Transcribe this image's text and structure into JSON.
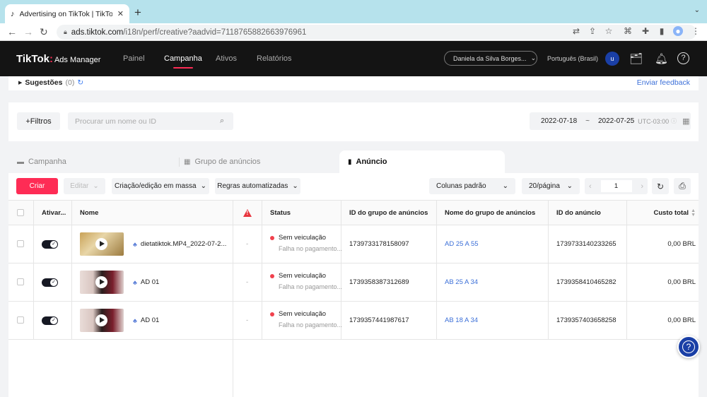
{
  "browser": {
    "tab_title": "Advertising on TikTok | TikTok Ads",
    "url_host": "ads.tiktok.com",
    "url_path": "/i18n/perf/creative?aadvid=7118765882663976961"
  },
  "header": {
    "logo": "TikTok",
    "product": "Ads Manager",
    "nav": [
      {
        "label": "Painel"
      },
      {
        "label": "Campanha"
      },
      {
        "label": "Ativos"
      },
      {
        "label": "Relatórios"
      }
    ],
    "account": "Daniela da Silva Borges...",
    "language": "Português (Brasil)",
    "avatar": "u"
  },
  "suggestions": {
    "label": "Sugestões",
    "count": "(0)",
    "feedback": "Enviar feedback"
  },
  "filters": {
    "filter_button": "+Filtros",
    "search_placeholder": "Procurar um nome ou ID",
    "date_start": "2022-07-18",
    "date_sep": "~",
    "date_end": "2022-07-25",
    "timezone": "UTC-03:00"
  },
  "level_tabs": {
    "campaign": "Campanha",
    "adgroup": "Grupo de anúncios",
    "ad": "Anúncio"
  },
  "toolbar": {
    "create": "Criar",
    "edit": "Editar",
    "bulk": "Criação/edição em massa",
    "rules": "Regras automatizadas",
    "columns": "Colunas padrão",
    "per_page": "20/página",
    "page": "1"
  },
  "table": {
    "headers": {
      "activate": "Ativar...",
      "name": "Nome",
      "status": "Status",
      "adgroup_id": "ID do grupo de anúncios",
      "adgroup_name": "Nome do grupo de anúncios",
      "ad_id": "ID do anúncio",
      "cost": "Custo total"
    },
    "rows": [
      {
        "name": "dietatiktok.MP4_2022-07-2...",
        "issue": "-",
        "status": "Sem veiculação",
        "status_sub": "Falha no pagamento...",
        "adgroup_id": "1739733178158097",
        "adgroup_name": "AD 25 A 55",
        "ad_id": "1739733140233265",
        "cost": "0,00 BRL"
      },
      {
        "name": "AD 01",
        "issue": "-",
        "status": "Sem veiculação",
        "status_sub": "Falha no pagamento...",
        "adgroup_id": "1739358387312689",
        "adgroup_name": "AB 25 A 34",
        "ad_id": "1739358410465282",
        "cost": "0,00 BRL"
      },
      {
        "name": "AD 01",
        "issue": "-",
        "status": "Sem veiculação",
        "status_sub": "Falha no pagamento...",
        "adgroup_id": "1739357441987617",
        "adgroup_name": "AB 18 A 34",
        "ad_id": "1739357403658258",
        "cost": "0,00 BRL"
      }
    ]
  },
  "colors": {
    "accent": "#fe2c55",
    "brand_dark": "#141414",
    "link": "#3b6fd8",
    "error": "#f0414d"
  }
}
